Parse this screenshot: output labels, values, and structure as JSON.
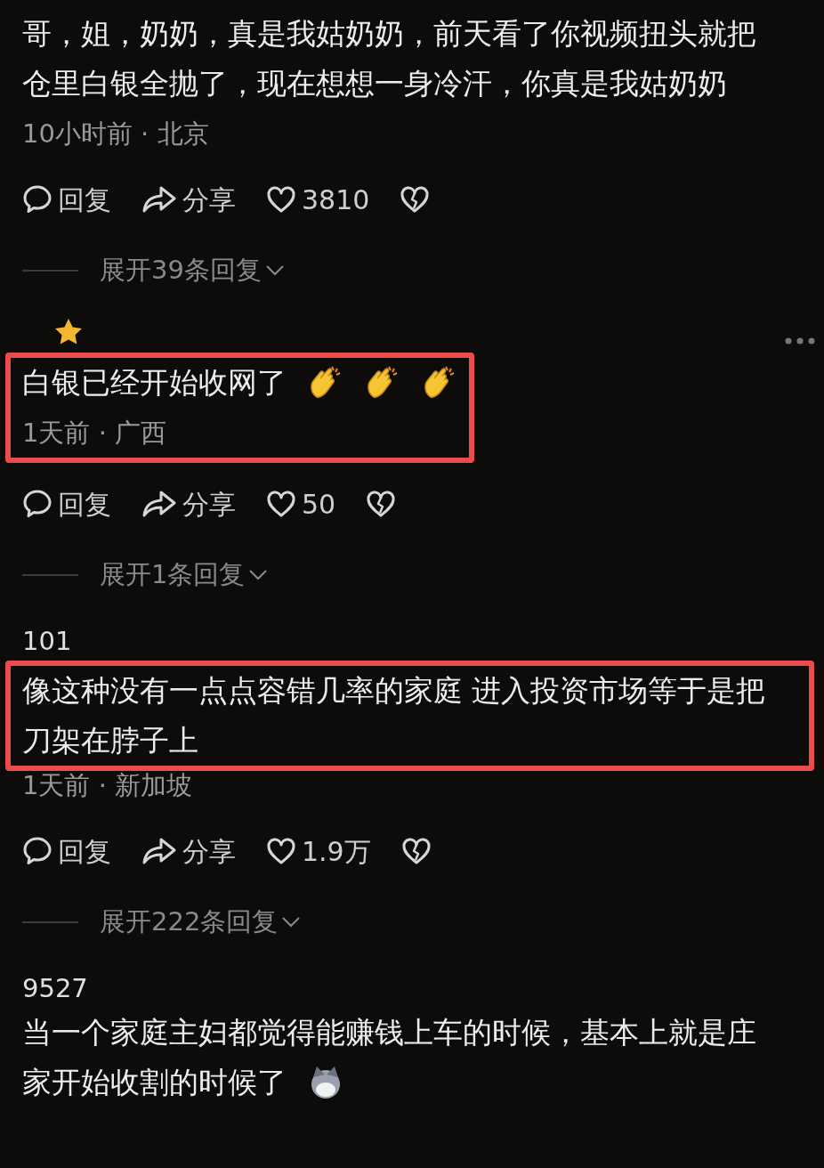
{
  "comments": [
    {
      "starred": false,
      "text_lines": [
        "哥，姐，奶奶，真是我姑奶奶，前天看了你视频扭头就把",
        "仓里白银全抛了，现在想想一身冷汗，你真是我姑奶奶"
      ],
      "meta": "10小时前 · 北京",
      "reply": "回复",
      "share": "分享",
      "likes": "3810",
      "expand": "展开39条回复"
    },
    {
      "starred": true,
      "more": true,
      "highlighted": true,
      "highlight_includes_meta": true,
      "text_lines": [
        "白银已经开始收网了"
      ],
      "emojis": [
        {
          "kind": "clap"
        },
        {
          "kind": "clap"
        },
        {
          "kind": "clap"
        }
      ],
      "meta": "1天前 · 广西",
      "reply": "回复",
      "share": "分享",
      "likes": "50",
      "expand": "展开1条回复"
    },
    {
      "starred": false,
      "author": "101",
      "highlighted": true,
      "highlight_includes_meta": false,
      "text_lines": [
        "像这种没有一点点容错几率的家庭  进入投资市场等于是把",
        "刀架在脖子上"
      ],
      "meta": "1天前 · 新加坡",
      "reply": "回复",
      "share": "分享",
      "likes": "1.9万",
      "expand": "展开222条回复"
    },
    {
      "starred": false,
      "author": "9527",
      "text_lines": [
        "当一个家庭主妇都觉得能赚钱上车的时候，基本上就是庄",
        "家开始收割的时候了"
      ],
      "emojis": [
        {
          "kind": "face"
        }
      ]
    }
  ]
}
